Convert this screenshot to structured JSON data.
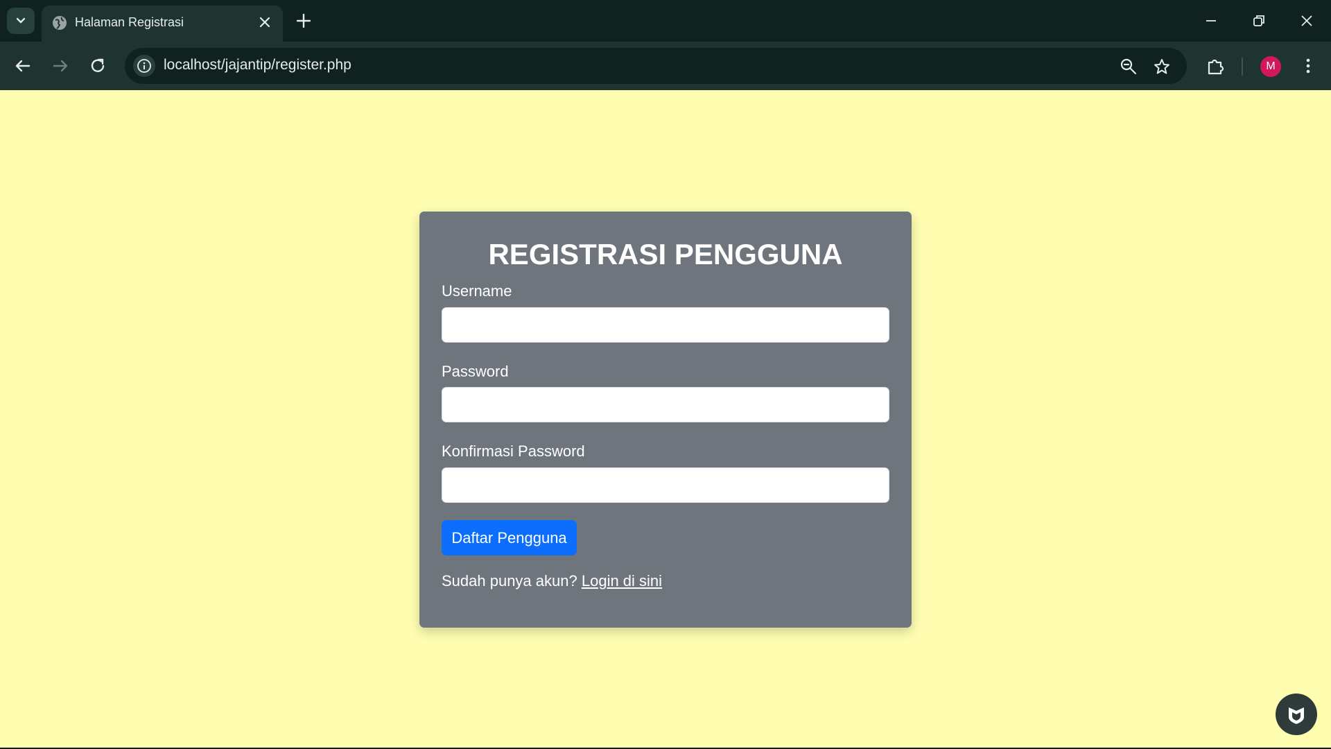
{
  "browser": {
    "tab_title": "Halaman Registrasi",
    "url": "localhost/jajantip/register.php",
    "avatar_letter": "M",
    "icons": [
      "tab-list-icon",
      "globe-icon",
      "close-icon",
      "plus-icon",
      "minimize-icon",
      "restore-icon",
      "window-close-icon",
      "back-icon",
      "forward-icon",
      "reload-icon",
      "info-icon",
      "zoom-icon",
      "star-icon",
      "extensions-icon",
      "more-icon"
    ]
  },
  "form": {
    "title": "REGISTRASI PENGGUNA",
    "username_label": "Username",
    "username_value": "",
    "password_label": "Password",
    "password_value": "",
    "confirm_label": "Konfirmasi Password",
    "confirm_value": "",
    "submit_label": "Daftar Pengguna",
    "login_prompt": "Sudah punya akun?",
    "login_link": "Login di sini"
  },
  "colors": {
    "page_bg": "#fefdb0",
    "card_bg": "#6e757d",
    "button_bg": "#0d6efd",
    "chrome_dark": "#0f2220",
    "chrome_toolbar": "#1f3431"
  }
}
